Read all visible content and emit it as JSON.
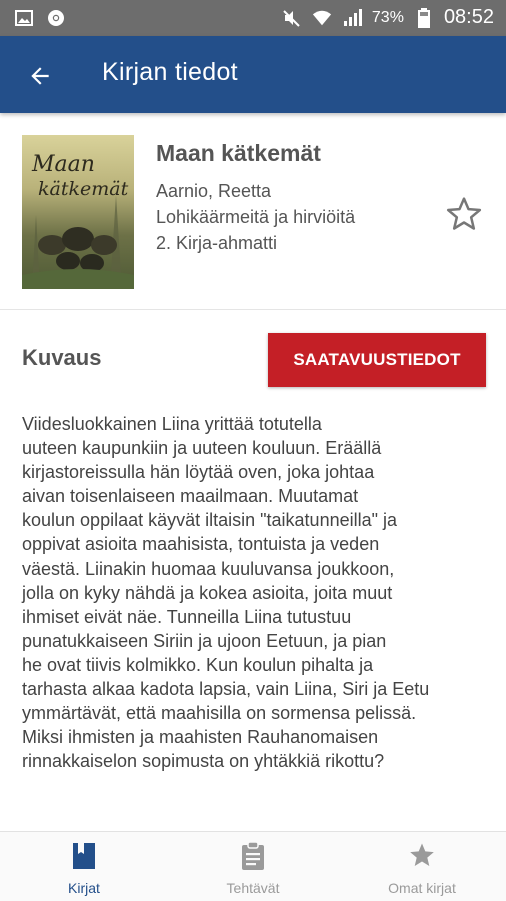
{
  "status_bar": {
    "battery": "73%",
    "time": "08:52",
    "icons": [
      "gallery-icon",
      "chrome-icon",
      "mute-icon",
      "wifi-icon",
      "signal-icon",
      "battery-icon"
    ]
  },
  "app_bar": {
    "title": "Kirjan tiedot",
    "back_icon": "arrow-back-icon"
  },
  "book": {
    "title": "Maan kätkemät",
    "author": "Aarnio, Reetta",
    "series": "Lohikäärmeitä ja hirviöitä",
    "series_volume": "2. Kirja-ahmatti",
    "cover_title_line1": "Maan",
    "cover_title_line2": "kätkemät",
    "favorite_icon": "star-outline-icon"
  },
  "description": {
    "heading": "Kuvaus",
    "availability_button": "SAATAVUUSTIEDOT",
    "lines": [
      "Viidesluokkainen Liina yrittää totutella",
      "uuteen kaupunkiin ja uuteen kouluun. Eräällä",
      "kirjastoreissulla hän löytää oven, joka johtaa",
      "aivan toisenlaiseen maailmaan. Muutamat",
      "koulun oppilaat käyvät iltaisin \"taikatunneilla\" ja",
      "oppivat asioita maahisista, tontuista ja veden",
      "väestä. Liinakin huomaa kuuluvansa joukkoon,",
      "jolla on kyky nähdä ja kokea asioita, joita muut",
      "ihmiset eivät näe. Tunneilla Liina tutustuu",
      "punatukkaiseen Siriin ja ujoon Eetuun, ja pian",
      "he ovat tiivis kolmikko. Kun koulun pihalta ja",
      "tarhasta alkaa kadota lapsia, vain Liina, Siri ja Eetu",
      "ymmärtävät, että maahisilla on sormensa pelissä.",
      "Miksi ihmisten ja maahisten Rauhanomaisen",
      "rinnakkaiselon sopimusta on yhtäkkiä rikottu?"
    ]
  },
  "bottom_nav": {
    "items": [
      {
        "label": "Kirjat",
        "icon": "book-icon",
        "active": true
      },
      {
        "label": "Tehtävät",
        "icon": "clipboard-icon",
        "active": false
      },
      {
        "label": "Omat kirjat",
        "icon": "star-icon",
        "active": false
      }
    ]
  },
  "colors": {
    "app_bar": "#234f8a",
    "accent_button": "#c41f26",
    "status_bar": "#6d6d6d",
    "nav_active": "#234f8a",
    "nav_inactive": "#9a9a9a"
  }
}
